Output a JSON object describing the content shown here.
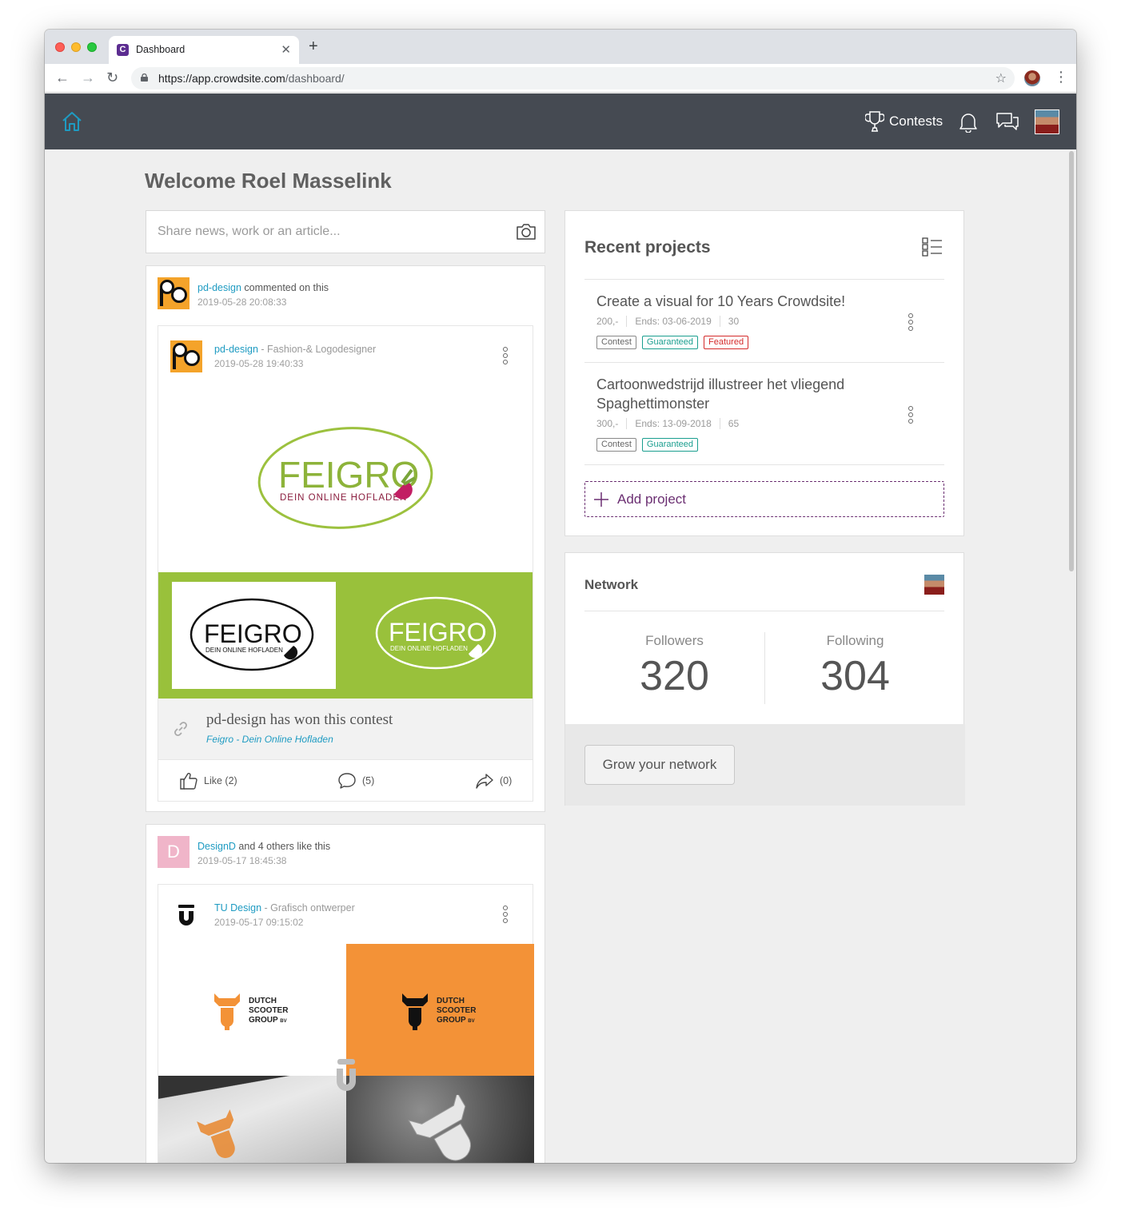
{
  "browser": {
    "tab_title": "Dashboard",
    "tab_favicon_letter": "C",
    "url_host": "https://app.crowdsite.com",
    "url_path": "/dashboard/"
  },
  "header": {
    "contests_label": "Contests"
  },
  "welcome": "Welcome Roel Masselink",
  "share": {
    "placeholder": "Share news, work or an article..."
  },
  "feed": [
    {
      "actor": "pd-design",
      "action": "commented on this",
      "time": "2019-05-28 20:08:33",
      "post_author": "pd-design",
      "post_author_role": "Fashion-& Logodesigner",
      "post_time": "2019-05-28 19:40:33",
      "won_title": "pd-design has won this contest",
      "won_contest": "Feigro - Dein Online Hofladen",
      "like_label": "Like (2)",
      "comment_count": "(5)",
      "share_count": "(0)"
    },
    {
      "actor": "DesignD",
      "actor_initial": "D",
      "action": "and 4 others like this",
      "time": "2019-05-17 18:45:38",
      "post_author": "TU Design",
      "post_author_role": "Grafisch ontwerper",
      "post_time": "2019-05-17 09:15:02"
    }
  ],
  "logos": {
    "feigro_word": "FEIGRO",
    "feigro_tagline": "DEIN ONLINE HOFLADEN",
    "dutch_line1": "DUTCH",
    "dutch_line2": "SCOOTER",
    "dutch_line3": "GROUP",
    "dutch_suffix": "BV"
  },
  "recent_projects": {
    "title": "Recent projects",
    "items": [
      {
        "title": "Create a visual for 10 Years Crowdsite!",
        "price": "200,-",
        "ends": "Ends: 03-06-2019",
        "entries": "30",
        "tags": [
          "Contest",
          "Guaranteed",
          "Featured"
        ]
      },
      {
        "title": "Cartoonwedstrijd illustreer het vliegend Spaghettimonster",
        "price": "300,-",
        "ends": "Ends: 13-09-2018",
        "entries": "65",
        "tags": [
          "Contest",
          "Guaranteed"
        ]
      }
    ],
    "add_label": "Add project"
  },
  "network": {
    "title": "Network",
    "followers_label": "Followers",
    "followers_count": "320",
    "following_label": "Following",
    "following_count": "304",
    "grow_label": "Grow your network"
  },
  "colors": {
    "header_bg": "#454a52",
    "link": "#1e9bc2",
    "accent_purple": "#6b2f72",
    "feigro_green": "#99c13b",
    "dutch_orange": "#f39237"
  }
}
